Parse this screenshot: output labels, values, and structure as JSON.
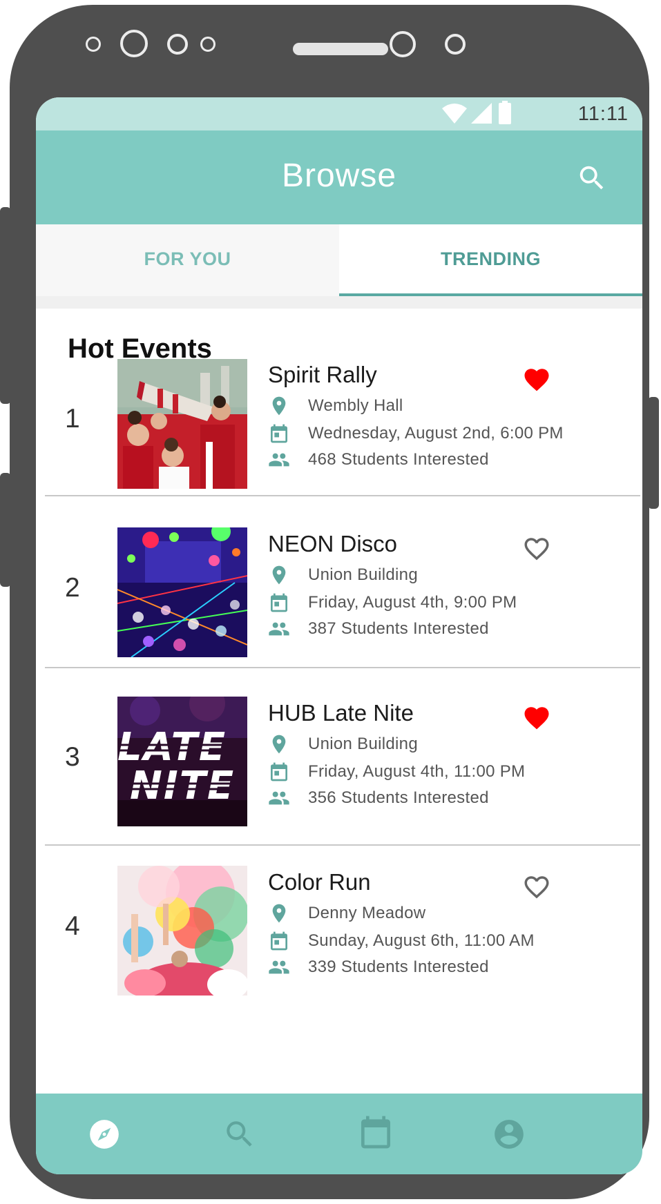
{
  "status_bar": {
    "time": "11:11",
    "icons": [
      "wifi-icon",
      "signal-icon",
      "battery-icon"
    ]
  },
  "app_bar": {
    "title": "Browse",
    "action_icon": "search-icon"
  },
  "tabs": [
    {
      "label": "FOR YOU",
      "selected": false
    },
    {
      "label": "TRENDING",
      "selected": true
    }
  ],
  "section_title": "Hot Events",
  "events": [
    {
      "rank": "1",
      "name": "Spirit Rally",
      "location": "Wembly Hall",
      "datetime": "Wednesday, August 2nd, 6:00 PM",
      "interested": "468 Students Interested",
      "favorited": true
    },
    {
      "rank": "2",
      "name": "NEON Disco",
      "location": "Union Building",
      "datetime": "Friday, August 4th, 9:00 PM",
      "interested": "387 Students Interested",
      "favorited": false
    },
    {
      "rank": "3",
      "name": "HUB Late Nite",
      "location": "Union Building",
      "datetime": "Friday, August 4th, 11:00 PM",
      "interested": "356 Students Interested",
      "favorited": true
    },
    {
      "rank": "4",
      "name": "Color Run",
      "location": "Denny Meadow",
      "datetime": "Sunday, August 6th, 11:00 AM",
      "interested": "339 Students Interested",
      "favorited": false
    }
  ],
  "late_nite_image_text": [
    "LATE",
    "NITE"
  ],
  "bottom_nav": [
    {
      "icon": "compass-icon",
      "active": true
    },
    {
      "icon": "search-icon",
      "active": false
    },
    {
      "icon": "calendar-icon",
      "active": false
    },
    {
      "icon": "account-icon",
      "active": false
    }
  ],
  "colors": {
    "primary": "#7fcbc2",
    "status_bar": "#bde4df",
    "accent": "#5aa9a2",
    "favorite": "#ff0000",
    "nav_icon": "#5fa59d"
  }
}
